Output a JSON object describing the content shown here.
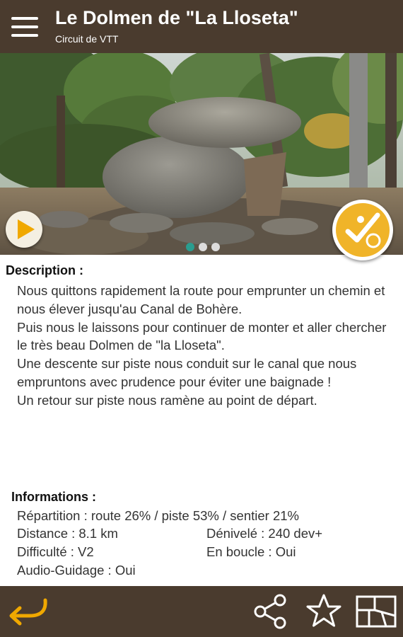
{
  "header": {
    "title": "Le Dolmen de \"La Lloseta\"",
    "subtitle": "Circuit de VTT",
    "menu_icon": "hamburger-menu-icon",
    "bar_color": "#4a3b2e"
  },
  "photo": {
    "play_icon": "play-icon",
    "visited_icon": "checkmark-badge-icon",
    "accent_color": "#f0a800",
    "pager": {
      "count": 3,
      "active_index": 0,
      "active_color": "#2a9d8f",
      "inactive_color": "#dddddd"
    }
  },
  "description": {
    "label": "Description :",
    "paragraphs": [
      "Nous quittons rapidement la route pour emprunter un chemin et nous élever jusqu'au Canal de Bohère.",
      "Puis nous le laissons pour continuer de monter et aller chercher le très beau Dolmen de \"la Lloseta\".",
      "Une descente sur piste nous conduit sur le canal que nous empruntons avec prudence pour éviter une baignade !",
      "Un retour sur piste nous ramène au point de départ."
    ]
  },
  "informations": {
    "label": "Informations :",
    "repartition": "Répartition : route 26% / piste 53% / sentier 21%",
    "distance": "Distance : 8.1 km",
    "denivele": "Dénivelé : 240 dev+",
    "difficulte": "Difficulté : V2",
    "en_boucle": "En boucle : Oui",
    "audio": "Audio-Guidage : Oui"
  },
  "bottom_bar": {
    "back_icon": "back-arrow-icon",
    "share_icon": "share-icon",
    "favorite_icon": "star-icon",
    "map_icon": "map-icon"
  }
}
